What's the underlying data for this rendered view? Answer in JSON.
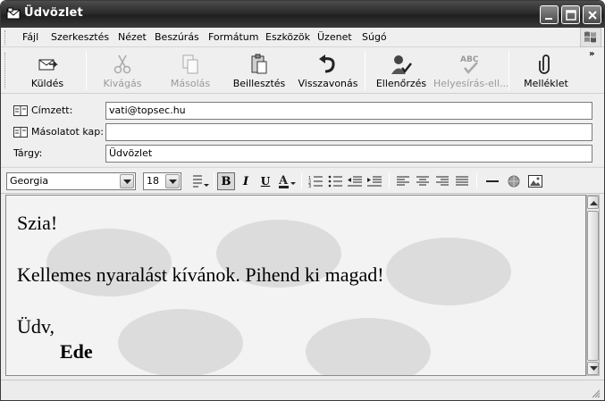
{
  "window": {
    "title": "Üdvözlet"
  },
  "menu": {
    "items": [
      "Fájl",
      "Szerkesztés",
      "Nézet",
      "Beszúrás",
      "Formátum",
      "Eszközök",
      "Üzenet",
      "Súgó"
    ]
  },
  "toolbar": {
    "buttons": [
      {
        "label": "Küldés",
        "icon": "send-icon",
        "enabled": true
      },
      {
        "label": "Kivágás",
        "icon": "scissors-icon",
        "enabled": false
      },
      {
        "label": "Másolás",
        "icon": "copy-icon",
        "enabled": false
      },
      {
        "label": "Beillesztés",
        "icon": "paste-icon",
        "enabled": true
      },
      {
        "label": "Visszavonás",
        "icon": "undo-icon",
        "enabled": true
      },
      {
        "label": "Ellenőrzés",
        "icon": "check-names-icon",
        "enabled": true
      },
      {
        "label": "Helyesírás-ell...",
        "icon": "spelling-icon",
        "enabled": false
      },
      {
        "label": "Melléklet",
        "icon": "paperclip-icon",
        "enabled": true
      }
    ],
    "overflow": "»"
  },
  "headers": {
    "to_label": "Címzett:",
    "to_value": "vati@topsec.hu",
    "cc_label": "Másolatot kap:",
    "cc_value": "",
    "subject_label": "Tárgy:",
    "subject_value": "Üdvözlet"
  },
  "format": {
    "font": "Georgia",
    "size": "18"
  },
  "message": {
    "lines": [
      "Szia!",
      "Kellemes nyaralást kívánok. Pihend ki magad!",
      "Üdv,"
    ],
    "signature": "Ede"
  }
}
